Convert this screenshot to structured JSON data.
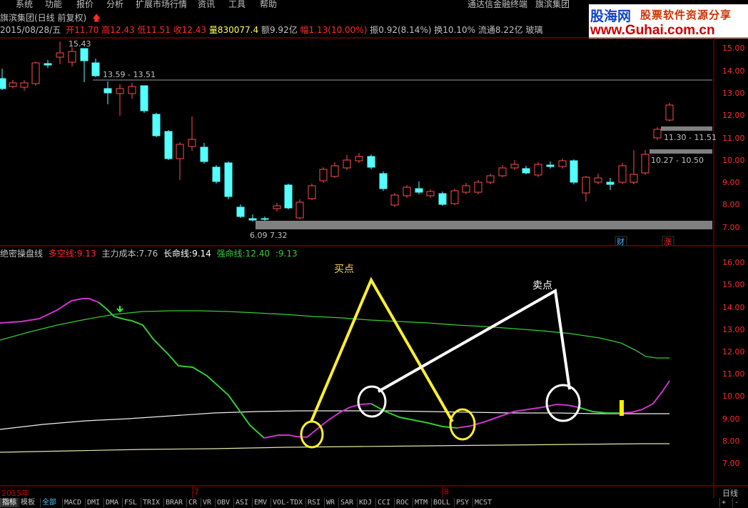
{
  "menu": {
    "items": [
      "系统",
      "功能",
      "报价",
      "分析",
      "扩展市场行情",
      "资讯",
      "工具",
      "帮助"
    ],
    "right_items": [
      "通达信金融终端",
      "旗滨集团"
    ]
  },
  "logo": {
    "cn": "股海网",
    "slogan": "股票软件资源分享",
    "url": "www.Guhai.com.cn"
  },
  "header": {
    "title": "旗滨集团(日线 前复权)",
    "arrow_icon": "up-arrow-icon",
    "date": "2015/08/28/五",
    "open_label": "开",
    "open": "11.70",
    "high_label": "高",
    "high": "12.43",
    "low_label": "低",
    "low": "11.51",
    "close_label": "收",
    "close": "12.43",
    "volume_label": "量",
    "volume": "830077.4",
    "amount_label": "额",
    "amount": "9.92亿",
    "change_label": "幅",
    "change": "1.13(10.00%)",
    "amplitude_label": "振",
    "amplitude": "0.92(8.14%)",
    "turnover_label": "换",
    "turnover": "10.10%",
    "float_label": "流通",
    "float": "8.22亿",
    "industry": "玻璃"
  },
  "price_chart": {
    "y_axis": [
      "15.00",
      "14.00",
      "13.00",
      "12.00",
      "11.00",
      "10.00",
      "9.00",
      "8.00",
      "7.00"
    ],
    "annotations": {
      "high_mark": "15.43",
      "range_a": "13.59 - 13.51",
      "range_b": "11.30 - 11.51",
      "range_c": "10.27 - 10.50",
      "low_mark": "6.09  7.32"
    },
    "badges": {
      "finance": "财",
      "rise": "涨"
    },
    "colors": {
      "up": "#ff4d4d",
      "down": "#54ffff",
      "zone": "#808080"
    }
  },
  "indicator": {
    "name": "绝密操盘线",
    "items": [
      {
        "label": "多空线:",
        "value": "9.13",
        "color": "#ff2a2a"
      },
      {
        "label": "主力成本:",
        "value": "7.76",
        "color": "#c0c0c0"
      },
      {
        "label": "长命线:",
        "value": "9.14",
        "color": "#ffffff"
      },
      {
        "label": "强命线:",
        "value": "12.40",
        "color": "#33cc33"
      },
      {
        "label": ":",
        "value": "9.13",
        "color": "#33cc33"
      }
    ],
    "y_axis": [
      "16.00",
      "15.00",
      "14.00",
      "13.00",
      "12.00",
      "11.00",
      "10.00",
      "9.00",
      "8.00",
      "7.00"
    ],
    "buy_label": "买点",
    "sell_label": "卖点"
  },
  "time_axis": {
    "labels": [
      "2015年",
      "7",
      "8"
    ],
    "period": "日线"
  },
  "bottom_tabs": {
    "left": [
      "指标",
      "模板",
      "全部"
    ],
    "tabs": [
      "MACD",
      "DMI",
      "DMA",
      "FSL",
      "TRIX",
      "BRAR",
      "CR",
      "VR",
      "OBV",
      "ASI",
      "EMV",
      "VOL-TDX",
      "RSI",
      "WR",
      "SAR",
      "KDJ",
      "CCI",
      "ROC",
      "MTM",
      "BOLL",
      "PSY",
      "MCST"
    ],
    "right": [
      "+",
      "-"
    ]
  }
}
